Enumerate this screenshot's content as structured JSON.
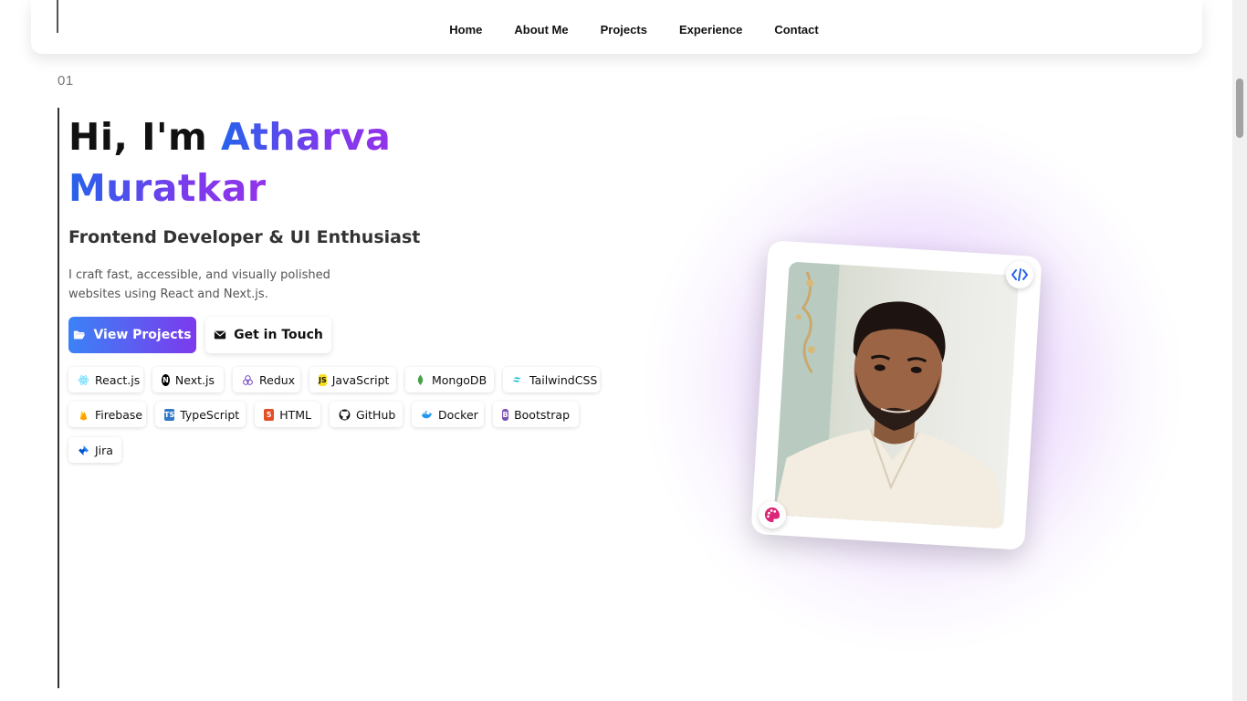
{
  "nav": {
    "links": [
      "Home",
      "About Me",
      "Projects",
      "Experience",
      "Contact"
    ]
  },
  "hero": {
    "section_number": "01",
    "greeting": "Hi, I'm",
    "first_name": "Atharva",
    "last_name": "Muratkar",
    "subtitle": "Frontend Developer & UI Enthusiast",
    "description": "I craft fast, accessible, and visually polished websites using React and Next.js.",
    "primary_button": "View Projects",
    "secondary_button": "Get in Touch"
  },
  "skills": [
    {
      "label": "React.js",
      "icon": "react-icon",
      "color": "#61dafb"
    },
    {
      "label": "Next.js",
      "icon": "nextjs-icon",
      "color": "#000000"
    },
    {
      "label": "Redux",
      "icon": "redux-icon",
      "color": "#764abc"
    },
    {
      "label": "JavaScript",
      "icon": "javascript-icon",
      "color": "#f7df1e"
    },
    {
      "label": "MongoDB",
      "icon": "mongodb-icon",
      "color": "#47a248"
    },
    {
      "label": "TailwindCSS",
      "icon": "tailwind-icon",
      "color": "#06b6d4"
    },
    {
      "label": "Firebase",
      "icon": "firebase-icon",
      "color": "#ffca28"
    },
    {
      "label": "TypeScript",
      "icon": "typescript-icon",
      "color": "#3178c6"
    },
    {
      "label": "HTML",
      "icon": "html-icon",
      "color": "#e34f26"
    },
    {
      "label": "GitHub",
      "icon": "github-icon",
      "color": "#181717"
    },
    {
      "label": "Docker",
      "icon": "docker-icon",
      "color": "#2496ed"
    },
    {
      "label": "Bootstrap",
      "icon": "bootstrap-icon",
      "color": "#7952b3"
    },
    {
      "label": "Jira",
      "icon": "jira-icon",
      "color": "#0052cc"
    }
  ],
  "colors": {
    "gradient_start": "#2563eb",
    "gradient_end": "#9333ea",
    "glow": "#a855f7"
  }
}
